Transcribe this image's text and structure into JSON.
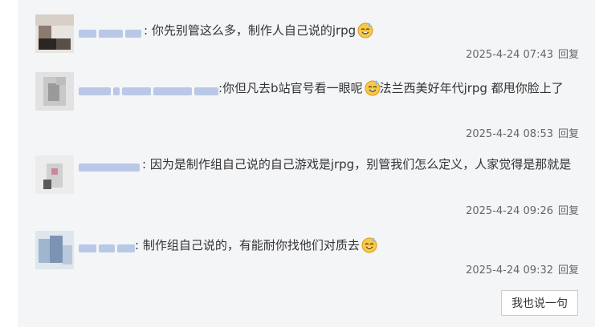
{
  "replies": [
    {
      "text": ": 你先别管这么多，制作人自己说的jrpg",
      "emoji": "sweat-smile-emoji",
      "after_emoji": "",
      "time": "2025-4-24 07:43",
      "reply_label": "回复"
    },
    {
      "text": ":你但凡去b站官号看一眼呢",
      "emoji": "sweat-smile-emoji",
      "after_emoji": "法兰西美好年代jrpg 都甩你脸上了",
      "time": "2025-4-24 08:53",
      "reply_label": "回复"
    },
    {
      "text": ": 因为是制作组自己说的自己游戏是jrpg，别管我们怎么定义，人家觉得是那就是",
      "emoji": "",
      "after_emoji": "",
      "time": "2025-4-24 09:26",
      "reply_label": "回复"
    },
    {
      "text": ": 制作组自己说的，有能耐你找他们对质去",
      "emoji": "sweat-smile-emoji",
      "after_emoji": "",
      "time": "2025-4-24 09:32",
      "reply_label": "回复"
    }
  ],
  "say_button_label": "我也说一句",
  "colors": {
    "panel_bg": "#f4f5f7",
    "text": "#333333",
    "meta": "#666666",
    "blurred_name": "#b9c8e6"
  }
}
